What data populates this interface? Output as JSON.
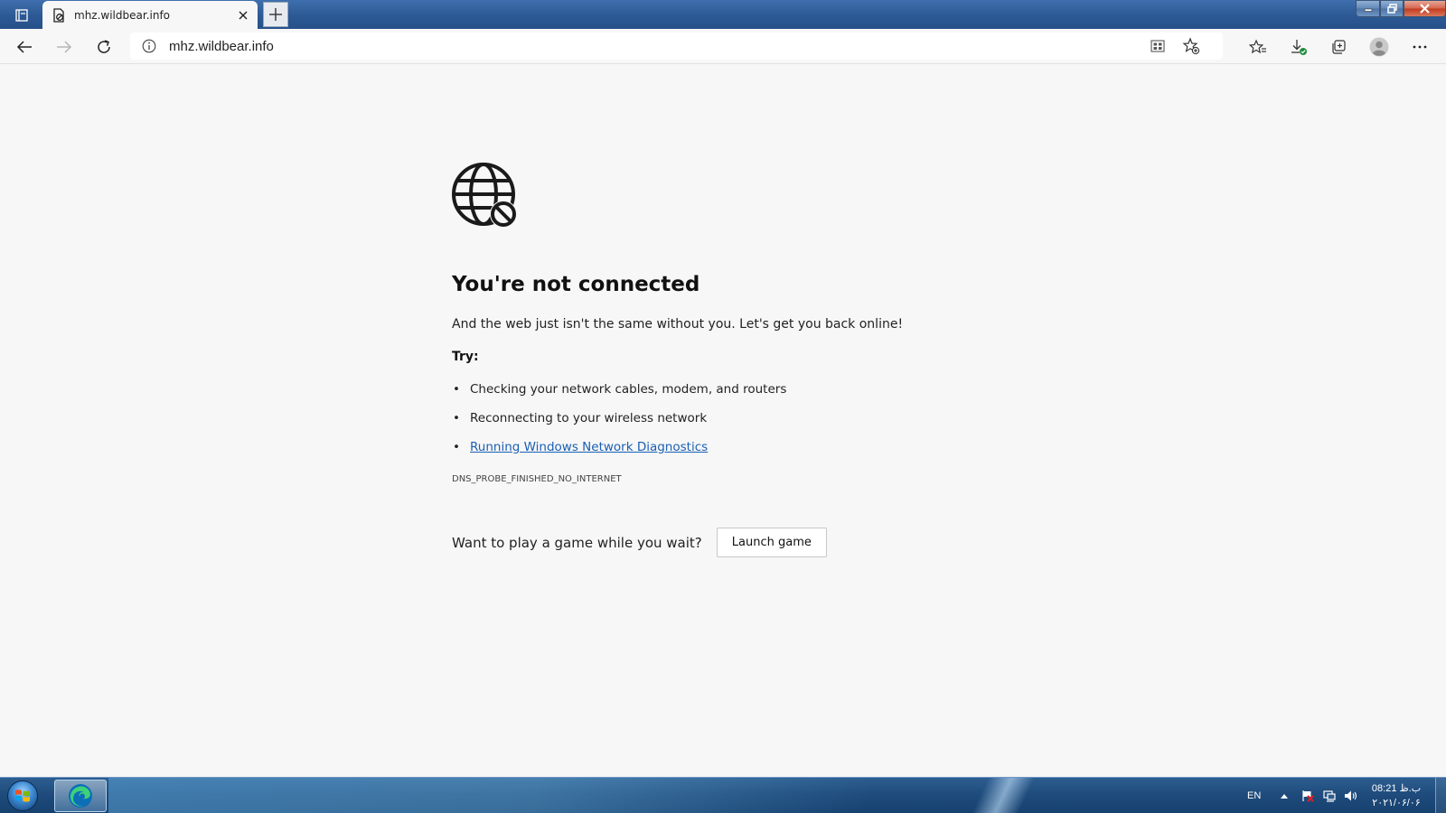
{
  "browser": {
    "tab": {
      "title": "mhz.wildbear.info",
      "favicon": "page-error-icon"
    },
    "address_bar": {
      "url": "mhz.wildbear.info",
      "info_icon": "info-icon"
    },
    "toolbar_icons": [
      "back-icon",
      "forward-icon",
      "refresh-icon",
      "immersive-reader-icon",
      "add-favorite-icon",
      "favorites-icon",
      "downloads-icon",
      "collections-icon",
      "profile-icon",
      "more-icon"
    ]
  },
  "error_page": {
    "heading": "You're not connected",
    "subtext": "And the web just isn't the same without you. Let's get you back online!",
    "try_label": "Try:",
    "suggestions": [
      "Checking your network cables, modem, and routers",
      "Reconnecting to your wireless network"
    ],
    "diagnostics_link": "Running Windows Network Diagnostics",
    "error_code": "DNS_PROBE_FINISHED_NO_INTERNET",
    "game_prompt": "Want to play a game while you wait?",
    "game_button": "Launch game"
  },
  "taskbar": {
    "language": "EN",
    "time": "08:21 ب.ظ",
    "date": "۲۰۲۱/۰۶/۰۶"
  },
  "colors": {
    "link": "#1a5fb4",
    "titlebar": "#2c5994",
    "page_bg": "#f7f7f7"
  }
}
